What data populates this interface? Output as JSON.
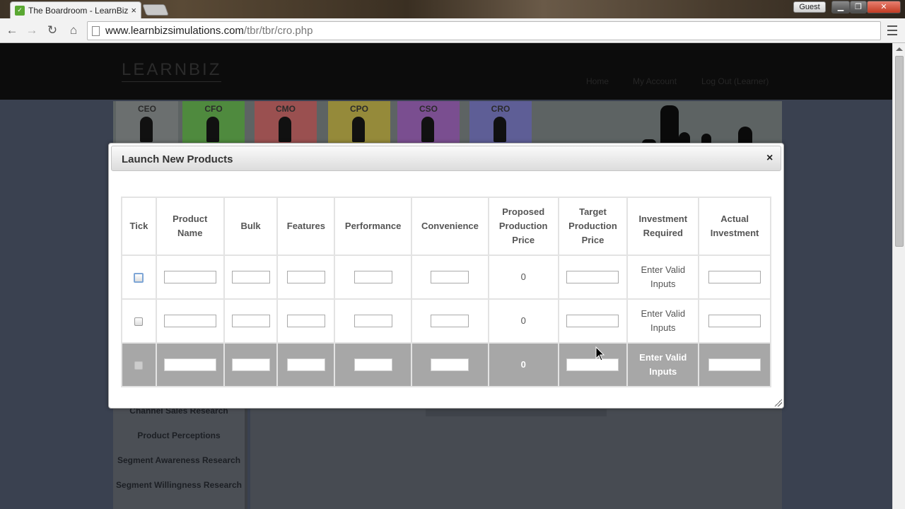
{
  "browser": {
    "tab_title": "The Boardroom - LearnBiz",
    "tab_close": "×",
    "guest_label": "Guest",
    "url_host": "www.learnbizsimulations.com",
    "url_path": "/tbr/tbr/cro.php"
  },
  "site": {
    "logo": "LEARNBIZ",
    "nav": {
      "home": "Home",
      "account": "My Account",
      "logout": "Log Out (Learner)"
    },
    "roles": [
      {
        "label": "CEO",
        "color": "#8e8e8e"
      },
      {
        "label": "CFO",
        "color": "#6fbf53"
      },
      {
        "label": "CMO",
        "color": "#d66a6a"
      },
      {
        "label": "CPO",
        "color": "#e0cf4c"
      },
      {
        "label": "CSO",
        "color": "#b46ad6"
      },
      {
        "label": "CRO",
        "color": "#8a8ae0"
      }
    ],
    "side_menu": [
      "Channel Sales Research",
      "Product Perceptions",
      "Segment Awareness Research",
      "Segment Willingness Research"
    ]
  },
  "modal": {
    "title": "Launch New Products",
    "close": "×",
    "columns": {
      "tick": "Tick",
      "name_1": "Product",
      "name_2": "Name",
      "bulk": "Bulk",
      "features": "Features",
      "performance": "Performance",
      "convenience": "Convenience",
      "proposed_1": "Proposed",
      "proposed_2": "Production",
      "proposed_3": "Price",
      "target_1": "Target",
      "target_2": "Production",
      "target_3": "Price",
      "invreq_1": "Investment",
      "invreq_2": "Required",
      "actual_1": "Actual",
      "actual_2": "Investment"
    },
    "rows": [
      {
        "proposed_price": "0",
        "inv_req_1": "Enter Valid",
        "inv_req_2": "Inputs"
      },
      {
        "proposed_price": "0",
        "inv_req_1": "Enter Valid",
        "inv_req_2": "Inputs"
      },
      {
        "proposed_price": "0",
        "inv_req_1": "Enter Valid",
        "inv_req_2": "Inputs"
      }
    ]
  }
}
